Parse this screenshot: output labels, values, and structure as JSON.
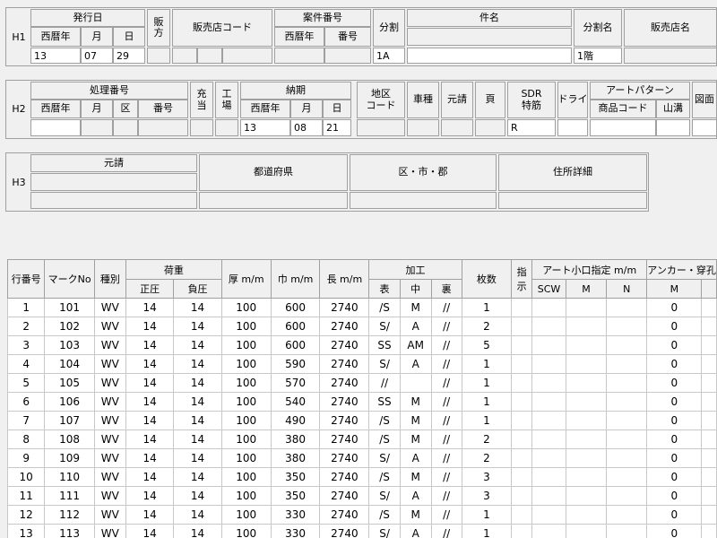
{
  "h1": {
    "label": "H1",
    "issue_date": {
      "title": "発行日",
      "year": "西暦年",
      "month": "月",
      "day": "日",
      "year_val": "13",
      "month_val": "07",
      "day_val": "29"
    },
    "sales_method": "販\n方",
    "dealer_code": "販売店コード",
    "case_no": {
      "title": "案件番号",
      "year": "西暦年",
      "number": "番号"
    },
    "split": "分割",
    "split_val": "1A",
    "subject": "件名",
    "split_name": "分割名",
    "split_name_val": "1階",
    "dealer_name": "販売店名"
  },
  "h2": {
    "label": "H2",
    "process_no": {
      "title": "処理番号",
      "year": "西暦年",
      "month": "月",
      "ward": "区",
      "number": "番号"
    },
    "allocation": "充\n当",
    "factory": "工\n場",
    "due": {
      "title": "納期",
      "year": "西暦年",
      "month": "月",
      "day": "日",
      "year_val": "13",
      "month_val": "08",
      "day_val": "21"
    },
    "area_code": "地区\nコード",
    "car_type": "車種",
    "subcontract": "元請",
    "page": "頁",
    "sdr": "SDR\n特筋",
    "sdr_val": "R",
    "dry": "ドライ",
    "art_pattern": {
      "title": "アートパターン",
      "product_code": "商品コード",
      "groove": "山溝"
    },
    "drawing": "図面"
  },
  "h3": {
    "label": "H3",
    "subcontract": "元請",
    "prefecture": "都道府県",
    "city": "区・市・郡",
    "address": "住所詳細"
  },
  "grid": {
    "headers": {
      "row_no": "行番号",
      "mark_no": "マークNo",
      "kind": "種別",
      "load": "荷重",
      "load_pos": "正圧",
      "load_neg": "負圧",
      "thickness": "厚 m/m",
      "width": "巾 m/m",
      "length": "長 m/m",
      "process": "加工",
      "proc_front": "表",
      "proc_mid": "中",
      "proc_back": "裏",
      "count": "枚数",
      "instruction": "指\n示",
      "art_hole": "アート小口指定 m/m",
      "scw": "SCW",
      "m": "M",
      "n": "N",
      "anchor": "アンカー・穿孔",
      "anchor_m": "M"
    },
    "rows": [
      {
        "rn": "1",
        "mark": "101",
        "kind": "WV",
        "pos": "14",
        "neg": "14",
        "t": "100",
        "w": "600",
        "l": "2740",
        "f": "/S",
        "m": "M",
        "b": "//",
        "c": "1",
        "am": "0"
      },
      {
        "rn": "2",
        "mark": "102",
        "kind": "WV",
        "pos": "14",
        "neg": "14",
        "t": "100",
        "w": "600",
        "l": "2740",
        "f": "S/",
        "m": "A",
        "b": "//",
        "c": "2",
        "am": "0"
      },
      {
        "rn": "3",
        "mark": "103",
        "kind": "WV",
        "pos": "14",
        "neg": "14",
        "t": "100",
        "w": "600",
        "l": "2740",
        "f": "SS",
        "m": "AM",
        "b": "//",
        "c": "5",
        "am": "0"
      },
      {
        "rn": "4",
        "mark": "104",
        "kind": "WV",
        "pos": "14",
        "neg": "14",
        "t": "100",
        "w": "590",
        "l": "2740",
        "f": "S/",
        "m": "A",
        "b": "//",
        "c": "1",
        "am": "0"
      },
      {
        "rn": "5",
        "mark": "105",
        "kind": "WV",
        "pos": "14",
        "neg": "14",
        "t": "100",
        "w": "570",
        "l": "2740",
        "f": "//",
        "m": "",
        "b": "//",
        "c": "1",
        "am": "0"
      },
      {
        "rn": "6",
        "mark": "106",
        "kind": "WV",
        "pos": "14",
        "neg": "14",
        "t": "100",
        "w": "540",
        "l": "2740",
        "f": "SS",
        "m": "M",
        "b": "//",
        "c": "1",
        "am": "0"
      },
      {
        "rn": "7",
        "mark": "107",
        "kind": "WV",
        "pos": "14",
        "neg": "14",
        "t": "100",
        "w": "490",
        "l": "2740",
        "f": "/S",
        "m": "M",
        "b": "//",
        "c": "1",
        "am": "0"
      },
      {
        "rn": "8",
        "mark": "108",
        "kind": "WV",
        "pos": "14",
        "neg": "14",
        "t": "100",
        "w": "380",
        "l": "2740",
        "f": "/S",
        "m": "M",
        "b": "//",
        "c": "2",
        "am": "0"
      },
      {
        "rn": "9",
        "mark": "109",
        "kind": "WV",
        "pos": "14",
        "neg": "14",
        "t": "100",
        "w": "380",
        "l": "2740",
        "f": "S/",
        "m": "A",
        "b": "//",
        "c": "2",
        "am": "0"
      },
      {
        "rn": "10",
        "mark": "110",
        "kind": "WV",
        "pos": "14",
        "neg": "14",
        "t": "100",
        "w": "350",
        "l": "2740",
        "f": "/S",
        "m": "M",
        "b": "//",
        "c": "3",
        "am": "0"
      },
      {
        "rn": "11",
        "mark": "111",
        "kind": "WV",
        "pos": "14",
        "neg": "14",
        "t": "100",
        "w": "350",
        "l": "2740",
        "f": "S/",
        "m": "A",
        "b": "//",
        "c": "3",
        "am": "0"
      },
      {
        "rn": "12",
        "mark": "112",
        "kind": "WV",
        "pos": "14",
        "neg": "14",
        "t": "100",
        "w": "330",
        "l": "2740",
        "f": "/S",
        "m": "M",
        "b": "//",
        "c": "1",
        "am": "0"
      },
      {
        "rn": "13",
        "mark": "113",
        "kind": "WV",
        "pos": "14",
        "neg": "14",
        "t": "100",
        "w": "330",
        "l": "2740",
        "f": "S/",
        "m": "A",
        "b": "//",
        "c": "1",
        "am": "0"
      }
    ]
  }
}
